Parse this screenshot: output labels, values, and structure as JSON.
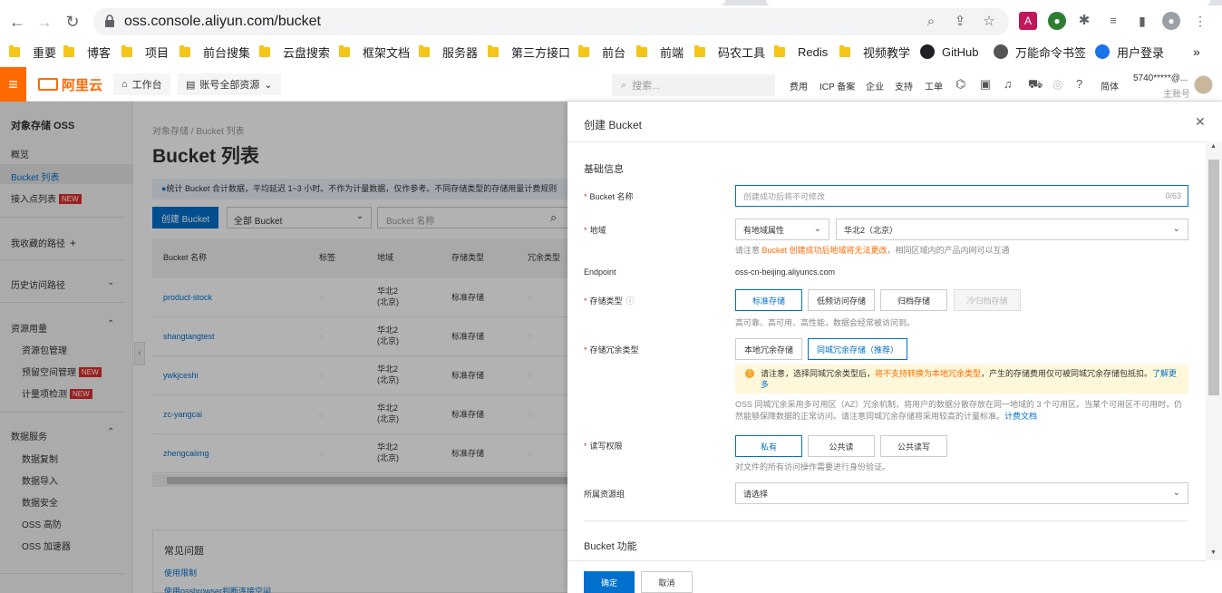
{
  "browser": {
    "url": "oss.console.aliyun.com/bucket",
    "bookmarks": [
      "重要",
      "博客",
      "项目",
      "前台搜集",
      "云盘搜索",
      "框架文档",
      "服务器",
      "第三方接口",
      "前台",
      "前端",
      "码农工具",
      "Redis",
      "视频教学",
      "GitHub",
      "万能命令书签",
      "用户登录"
    ]
  },
  "header": {
    "logo": "阿里云",
    "workbench": "工作台",
    "resources": "账号全部资源",
    "search_placeholder": "搜索...",
    "links": [
      "费用",
      "ICP 备案",
      "企业",
      "支持",
      "工单"
    ],
    "lang": "简体",
    "account": "5740*****@...",
    "account_sub": "主账号"
  },
  "sidebar": {
    "title": "对象存储 OSS",
    "overview": "概览",
    "bucket_list": "Bucket 列表",
    "access_points": "接入点列表",
    "new_tag": "NEW",
    "favorites": "我收藏的路径",
    "history": "历史访问路径",
    "resource_usage": "资源用量",
    "resource_pkg": "资源包管理",
    "reserved_space": "预留空间管理",
    "metering": "计量项检测",
    "data_service": "数据服务",
    "data_copy": "数据复制",
    "data_import": "数据导入",
    "data_security": "数据安全",
    "oss_ddos": "OSS 高防",
    "oss_accel": "OSS 加速器"
  },
  "main": {
    "breadcrumb": "对象存储 / Bucket 列表",
    "title": "Bucket 列表",
    "notice": "统计 Bucket 合计数据，平均延迟 1~3 小时。不作为计量数据，仅作参考。不同存储类型的存储用量计费规则",
    "create_button": "创建 Bucket",
    "filter": "全部 Bucket",
    "search_placeholder": "Bucket 名称",
    "columns": [
      "Bucket 名称",
      "标签",
      "地域",
      "存储类型",
      "冗余类型"
    ],
    "rows": [
      {
        "name": "product-stock",
        "region1": "华北2",
        "region2": "(北京)",
        "type": "标准存储"
      },
      {
        "name": "shangtangtest",
        "region1": "华北2",
        "region2": "(北京)",
        "type": "标准存储"
      },
      {
        "name": "ywkjceshi",
        "region1": "华北2",
        "region2": "(北京)",
        "type": "标准存储"
      },
      {
        "name": "zc-yangcai",
        "region1": "华北2",
        "region2": "(北京)",
        "type": "标准存储"
      },
      {
        "name": "zhengcaiimg",
        "region1": "华北2",
        "region2": "(北京)",
        "type": "标准存储"
      }
    ],
    "faq_title": "常见问题",
    "faq1": "使用限制",
    "faq2": "使用ossbrowser判断连接空间"
  },
  "drawer": {
    "title": "创建 Bucket",
    "section_basic": "基础信息",
    "bucket_name_label": "Bucket 名称",
    "bucket_name_placeholder": "创建成功后将不可修改",
    "bucket_name_count": "0/63",
    "region_label": "地域",
    "region_attr": "有地域属性",
    "region_value": "华北2（北京）",
    "region_hint_prefix": "请注意 ",
    "region_hint_warn": "Bucket 创建成功后地域将无法更改",
    "region_hint_suffix": "，相同区域内的产品内网可以互通",
    "endpoint_label": "Endpoint",
    "endpoint_value": "oss-cn-beijing.aliyuncs.com",
    "storage_type_label": "存储类型",
    "storage_types": [
      "标准存储",
      "低频访问存储",
      "归档存储",
      "冷归档存储"
    ],
    "storage_hint": "高可靠、高可用、高性能，数据会经常被访问到。",
    "redundancy_label": "存储冗余类型",
    "redundancy_types": [
      "本地冗余存储",
      "同城冗余存储（推荐）"
    ],
    "warn_prefix": "请注意，选择同城冗余类型后，",
    "warn_highlight": "将不支持转换为本地冗余类型",
    "warn_suffix": "，产生的存储费用仅可被同城冗余存储包抵扣。",
    "warn_link": "了解更多",
    "zrs_desc": "OSS 同城冗余采用多可用区（AZ）冗余机制，将用户的数据分散存放在同一地域的 3 个可用区。当某个可用区不可用时，仍然能够保障数据的正常访问。请注意同城冗余存储将采用较高的计量标准。",
    "zrs_link": "计费文档",
    "acl_label": "读写权限",
    "acl_types": [
      "私有",
      "公共读",
      "公共读写"
    ],
    "acl_hint": "对文件的所有访问操作需要进行身份验证。",
    "resource_group_label": "所属资源组",
    "resource_group_value": "请选择",
    "section_features": "Bucket 功能",
    "ok": "确定",
    "cancel": "取消"
  }
}
